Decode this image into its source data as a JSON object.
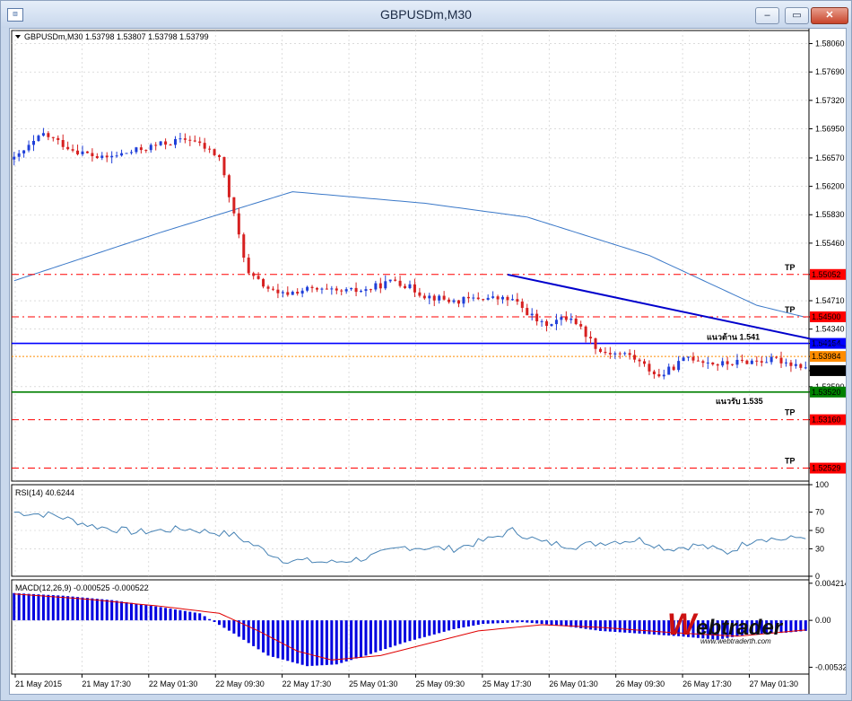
{
  "window": {
    "title": "GBPUSDm,M30",
    "icon_name": "chart-window-icon",
    "buttons": {
      "minimize": "–",
      "restore": "▭",
      "close": "✕"
    }
  },
  "chart_data": [
    {
      "type": "candlestick",
      "header": "GBPUSDm,M30  1.53798 1.53807 1.53798 1.53799",
      "ylim": [
        1.5236,
        1.5823
      ],
      "yticks": [
        "1.58060",
        "1.57690",
        "1.57320",
        "1.56950",
        "1.56570",
        "1.56200",
        "1.55830",
        "1.55460",
        "1.55052",
        "1.54710",
        "1.54500",
        "1.54340",
        "1.54154",
        "1.53984",
        "1.53799",
        "1.53590",
        "1.53520",
        "1.53160",
        "1.52529"
      ],
      "xticks": [
        "21 May 2015",
        "21 May 17:30",
        "22 May 01:30",
        "22 May 09:30",
        "22 May 17:30",
        "25 May 01:30",
        "25 May 09:30",
        "25 May 17:30",
        "26 May 01:30",
        "26 May 09:30",
        "26 May 17:30",
        "27 May 01:30"
      ],
      "close_anchor_points": [
        [
          0,
          1.5655
        ],
        [
          6,
          1.5688
        ],
        [
          12,
          1.5668
        ],
        [
          18,
          1.5656
        ],
        [
          24,
          1.5665
        ],
        [
          30,
          1.5675
        ],
        [
          36,
          1.5682
        ],
        [
          42,
          1.5658
        ],
        [
          48,
          1.5505
        ],
        [
          54,
          1.5478
        ],
        [
          60,
          1.5486
        ],
        [
          66,
          1.5482
        ],
        [
          72,
          1.5485
        ],
        [
          78,
          1.5498
        ],
        [
          84,
          1.5478
        ],
        [
          90,
          1.547
        ],
        [
          96,
          1.5475
        ],
        [
          102,
          1.5472
        ],
        [
          108,
          1.544
        ],
        [
          114,
          1.545
        ],
        [
          120,
          1.5405
        ],
        [
          126,
          1.54
        ],
        [
          132,
          1.5372
        ],
        [
          138,
          1.5398
        ],
        [
          144,
          1.5388
        ],
        [
          150,
          1.5392
        ],
        [
          156,
          1.5394
        ],
        [
          162,
          1.5385
        ]
      ],
      "price_lines": [
        {
          "name": "tp-line-1",
          "price": 1.55052,
          "label": "1.55052",
          "color": "#ff0000",
          "style": "dashed",
          "tag": "TP"
        },
        {
          "name": "tp-line-2",
          "price": 1.545,
          "label": "1.54500",
          "color": "#ff0000",
          "style": "dashed",
          "tag": "TP"
        },
        {
          "name": "resistance-line",
          "price": 1.54154,
          "label": "1.54154",
          "color": "#0000ff",
          "style": "solid",
          "annotation": "แนวต้าน 1.541",
          "annotation_color": "#0000cc"
        },
        {
          "name": "level-line",
          "price": 1.53984,
          "label": "1.53984",
          "color": "#ff8c00",
          "style": "dotted"
        },
        {
          "name": "support-line",
          "price": 1.5352,
          "label": "1.53520",
          "color": "#008000",
          "style": "solid",
          "annotation": "แนวรับ 1.535",
          "annotation_color": "#ff0000"
        },
        {
          "name": "tp-line-3",
          "price": 1.5316,
          "label": "1.53160",
          "color": "#ff0000",
          "style": "dashed",
          "tag": "TP"
        },
        {
          "name": "tp-line-4",
          "price": 1.52529,
          "label": "1.52529",
          "color": "#ff0000",
          "style": "dashed",
          "tag": "TP"
        }
      ],
      "bid_label": "1.53799",
      "trendline": {
        "from": [
          101,
          1.5505
        ],
        "to": [
          181,
          1.5397
        ],
        "color": "#0000cc"
      },
      "ma_anchor_points": [
        [
          0,
          1.5497
        ],
        [
          30,
          1.556
        ],
        [
          57,
          1.5613
        ],
        [
          84,
          1.5598
        ],
        [
          105,
          1.558
        ],
        [
          130,
          1.553
        ],
        [
          152,
          1.5465
        ],
        [
          170,
          1.5437
        ]
      ],
      "arrow": {
        "from": [
          185,
          1.5392
        ],
        "to": [
          192,
          1.5315
        ],
        "color": "#ff0000"
      },
      "colors": {
        "bull": "#1f3fd9",
        "bear": "#d62020",
        "ma": "#3a78c8",
        "grid": "#c8c8c8"
      }
    },
    {
      "type": "line",
      "header": "RSI(14) 40.6244",
      "ylim": [
        0,
        100
      ],
      "yticks": [
        "100",
        "70",
        "50",
        "30",
        "0"
      ],
      "anchor_points": [
        [
          0,
          70
        ],
        [
          8,
          67
        ],
        [
          16,
          55
        ],
        [
          25,
          48
        ],
        [
          35,
          52
        ],
        [
          45,
          45
        ],
        [
          55,
          18
        ],
        [
          65,
          15
        ],
        [
          72,
          20
        ],
        [
          80,
          32
        ],
        [
          90,
          30
        ],
        [
          97,
          40
        ],
        [
          102,
          50
        ],
        [
          108,
          37
        ],
        [
          115,
          33
        ],
        [
          122,
          38
        ],
        [
          128,
          40
        ],
        [
          134,
          30
        ],
        [
          140,
          34
        ],
        [
          146,
          26
        ],
        [
          152,
          42
        ],
        [
          158,
          40
        ],
        [
          164,
          46
        ],
        [
          172,
          40
        ]
      ],
      "color": "#4682b4"
    },
    {
      "type": "bar",
      "header": "MACD(12,26,9) -0.000525 -0.000522",
      "ylim": [
        -0.0061,
        0.0046
      ],
      "yticks": [
        "0.004214",
        "0.00",
        "-0.005325"
      ],
      "hist_anchor_points": [
        [
          0,
          0.0031
        ],
        [
          10,
          0.0028
        ],
        [
          20,
          0.0023
        ],
        [
          30,
          0.0015
        ],
        [
          38,
          0.0008
        ],
        [
          45,
          -0.0015
        ],
        [
          52,
          -0.004
        ],
        [
          60,
          -0.0052
        ],
        [
          66,
          -0.005
        ],
        [
          72,
          -0.004
        ],
        [
          80,
          -0.0025
        ],
        [
          90,
          -0.001
        ],
        [
          96,
          -0.0004
        ],
        [
          104,
          -0.0002
        ],
        [
          112,
          -0.0006
        ],
        [
          120,
          -0.0012
        ],
        [
          128,
          -0.0015
        ],
        [
          136,
          -0.0018
        ],
        [
          144,
          -0.0022
        ],
        [
          150,
          -0.0016
        ],
        [
          158,
          -0.0014
        ],
        [
          166,
          -0.001
        ],
        [
          172,
          -0.0006
        ]
      ],
      "signal_anchor_points": [
        [
          0,
          0.003
        ],
        [
          15,
          0.0024
        ],
        [
          30,
          0.0016
        ],
        [
          42,
          0.0008
        ],
        [
          50,
          -0.0012
        ],
        [
          58,
          -0.0035
        ],
        [
          65,
          -0.0045
        ],
        [
          75,
          -0.004
        ],
        [
          85,
          -0.0026
        ],
        [
          95,
          -0.0012
        ],
        [
          108,
          -0.0005
        ],
        [
          120,
          -0.0008
        ],
        [
          135,
          -0.0014
        ],
        [
          148,
          -0.0018
        ],
        [
          160,
          -0.0012
        ],
        [
          172,
          -0.0006
        ]
      ],
      "colors": {
        "hist": "#0000e0",
        "signal": "#e00000"
      }
    }
  ],
  "logo": {
    "text_main": "Webtrader",
    "text_url": "www.webtraderth.com",
    "w_color": "#cc1111",
    "text_color": "#111111"
  }
}
